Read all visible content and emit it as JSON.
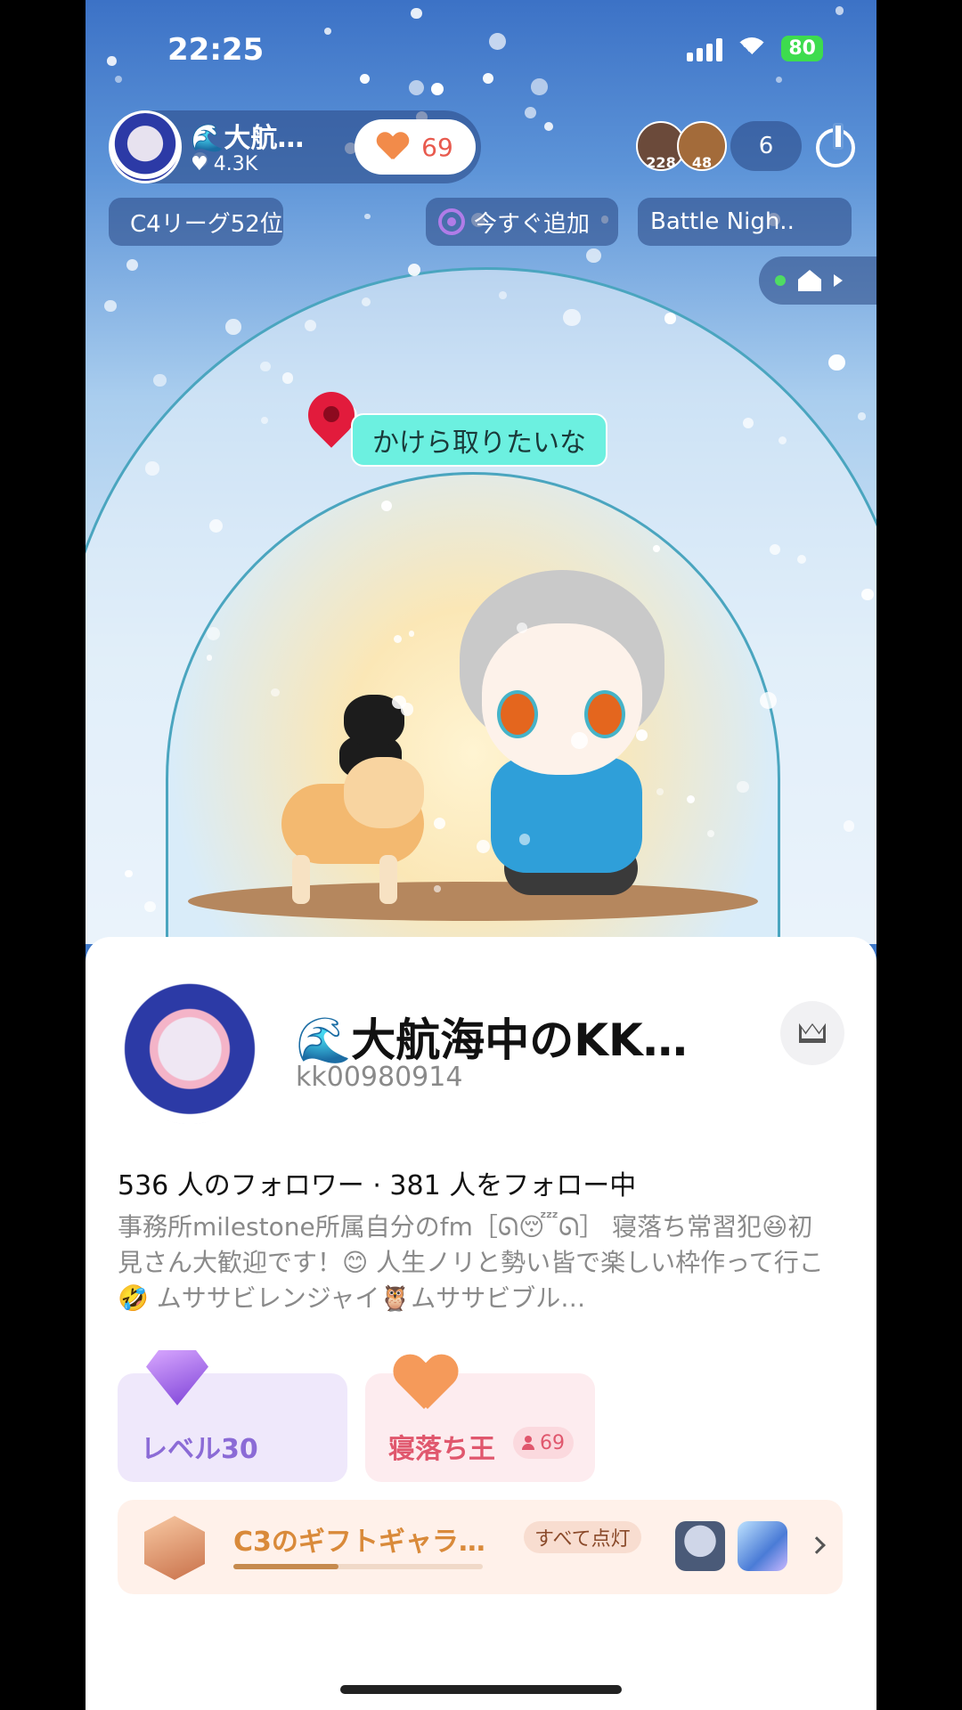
{
  "status_bar": {
    "time": "22:25",
    "battery": "80"
  },
  "host": {
    "name": "🌊大航…",
    "likes": "4.3K",
    "like_count": "69"
  },
  "viewers": {
    "avatars": [
      {
        "label": "228",
        "color": "#6b4a3a"
      },
      {
        "label": "48",
        "color": "#a36b3a"
      }
    ],
    "count": "6"
  },
  "chips": {
    "league": "C4リーグ52位",
    "add_now": "今すぐ追加",
    "battle": "Battle Nigh.."
  },
  "location_tag": "かけら取りたいな",
  "profile": {
    "name": "🌊大航海中のKK…",
    "id": "kk00980914",
    "follow_stats": "536 人のフォロワー · 381 人をフォロー中",
    "bio": "事務所milestone所属自分のfm［ᘏ😴ᘏ］ 寝落ち常習犯😆初見さん大歓迎です！😊 人生ノリと勢い皆で楽しい枠作って行こ🤣 ムササビレンジャイ🦉ムササビブル…"
  },
  "badges": {
    "level": "レベル30",
    "sleep_king": "寝落ち王",
    "sleep_count": "69"
  },
  "gallery": {
    "title": "C3のギフトギャラ…",
    "all_lit": "すべて点灯",
    "progress": 0.42
  },
  "colors": {
    "accent_orange": "#d98a3a",
    "level_purple": "#8b6bd6",
    "sleep_red": "#e0576d",
    "location_tag_bg": "#6cf0e0"
  }
}
